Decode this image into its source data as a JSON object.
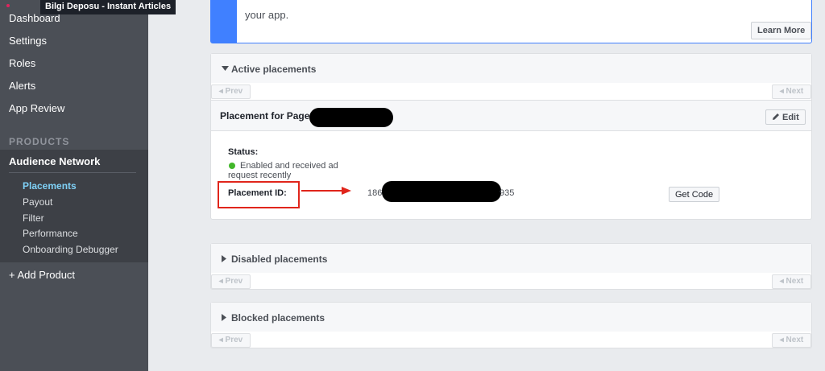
{
  "tooltip": "Bilgi Deposu - Instant Articles",
  "sidebar": {
    "items": [
      {
        "label": "Dashboard"
      },
      {
        "label": "Settings"
      },
      {
        "label": "Roles"
      },
      {
        "label": "Alerts"
      },
      {
        "label": "App Review"
      }
    ],
    "products_label": "PRODUCTS",
    "product": {
      "title": "Audience Network",
      "subitems": [
        {
          "label": "Placements",
          "active": true
        },
        {
          "label": "Payout"
        },
        {
          "label": "Filter"
        },
        {
          "label": "Performance"
        },
        {
          "label": "Onboarding Debugger"
        }
      ]
    },
    "add_product": "+ Add Product"
  },
  "info": {
    "text": "your app.",
    "learn_more": "Learn More"
  },
  "active": {
    "title": "Active placements",
    "prev": "◂ Prev",
    "next": "◂ Next",
    "placement": {
      "title": "Placement for Page",
      "edit": "Edit",
      "status_label": "Status:",
      "status_text": "Enabled and received ad request recently",
      "id_label": "Placement ID:",
      "id_prefix": "186",
      "id_suffix": "935",
      "get_code": "Get Code"
    }
  },
  "disabled": {
    "title": "Disabled placements",
    "prev": "◂ Prev",
    "next": "◂ Next"
  },
  "blocked": {
    "title": "Blocked placements",
    "prev": "◂ Prev",
    "next": "◂ Next"
  },
  "colors": {
    "sidebar": "#4b4f56",
    "accent": "#4080ff",
    "active_link": "#7fd1f7",
    "highlight": "#e0251b",
    "status_ok": "#42b72a"
  }
}
